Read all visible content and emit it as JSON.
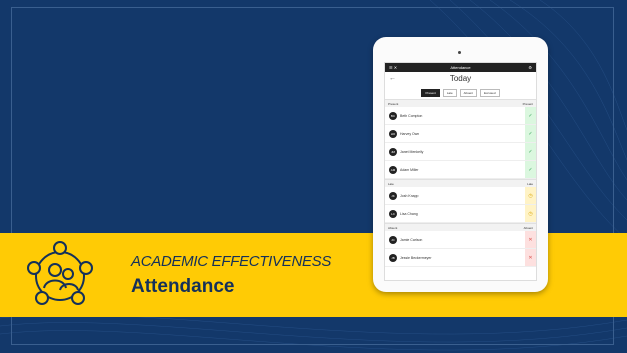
{
  "banner": {
    "subtitle": "ACADEMIC EFFECTIVENESS",
    "title": "Attendance"
  },
  "app": {
    "topbar_title": "Attendance",
    "menu_icon": "menu-icon",
    "close_icon": "close-icon",
    "settings_icon": "gear-icon",
    "back_icon": "back-arrow-icon",
    "day_label": "Today",
    "filters": [
      {
        "label": "Present",
        "active": true
      },
      {
        "label": "Late",
        "active": false
      },
      {
        "label": "Absent",
        "active": false
      },
      {
        "label": "Excused",
        "active": false
      }
    ],
    "sections": [
      {
        "label": "Present",
        "right": "Present",
        "status": "present",
        "icon": "check-icon",
        "students": [
          {
            "initials": "BC",
            "name": "Beth Compton"
          },
          {
            "initials": "HO",
            "name": "Harvey Own"
          },
          {
            "initials": "JM",
            "name": "Janet Menkelly"
          },
          {
            "initials": "AM",
            "name": "Adam Miller"
          }
        ]
      },
      {
        "label": "Late",
        "right": "Late",
        "status": "late",
        "icon": "clock-icon",
        "students": [
          {
            "initials": "JK",
            "name": "Josh Knapp"
          },
          {
            "initials": "LC",
            "name": "Lisa Chang"
          }
        ]
      },
      {
        "label": "Absent",
        "right": "Absent",
        "status": "absent",
        "icon": "x-icon",
        "students": [
          {
            "initials": "JC",
            "name": "Jamie Carlson"
          },
          {
            "initials": "JB",
            "name": "Jessie Beckermeyer"
          }
        ]
      }
    ]
  },
  "colors": {
    "background": "#13386a",
    "banner": "#ffcb05",
    "text": "#14305a"
  }
}
